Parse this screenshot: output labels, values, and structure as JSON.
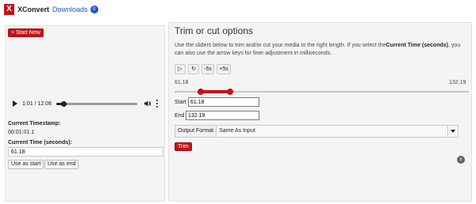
{
  "app": {
    "logo_letter": "X",
    "title": "XConvert",
    "downloads_label": "Downloads",
    "downloads_count": "0"
  },
  "left_panel": {
    "start_new_label": "+ Start New",
    "audio": {
      "current_time": "1:01",
      "duration": "12:08",
      "time_display": "1:01 / 12:08",
      "progress": 0.084
    },
    "current_timestamp_label": "Current Timestamp:",
    "current_timestamp_value": "00:01:01.1",
    "current_time_label": "Current Time (seconds):",
    "current_time_value": "61.18",
    "use_as_start_label": "Use as start",
    "use_as_end_label": "Use as end"
  },
  "right_panel": {
    "title": "Trim or cut options",
    "description_before": "Use the sliders below to trim and/or cut your media to the right length. If you select the",
    "description_bold": "Current Time (seconds)",
    "description_after": ", you can also use the arrow keys for finer adjustment in milliseconds.",
    "controls": {
      "play_symbol": "▷",
      "reload_symbol": "↻",
      "minus5_label": "-5s",
      "plus5_label": "+5s"
    },
    "range": {
      "min_label": "61.18",
      "max_label": "132.19",
      "start_fraction": 0.09,
      "end_fraction": 0.19
    },
    "start_label": "Start",
    "start_value": "61.18",
    "end_label": "End",
    "end_value": "132.19",
    "output_format_label": "Output Format",
    "output_format_value": "Same As Input",
    "trim_label": "Trim",
    "close_symbol": "x"
  },
  "colors": {
    "brand_red": "#c4121a",
    "link_blue": "#1a56c9",
    "panel_bg": "#f4f4f4"
  },
  "icons": {
    "logo": "x-logo-icon",
    "volume": "volume-icon",
    "more": "more-vertical-icon",
    "play": "play-icon",
    "reload": "reload-icon",
    "dropdown": "chevron-down-icon",
    "close": "close-icon"
  }
}
